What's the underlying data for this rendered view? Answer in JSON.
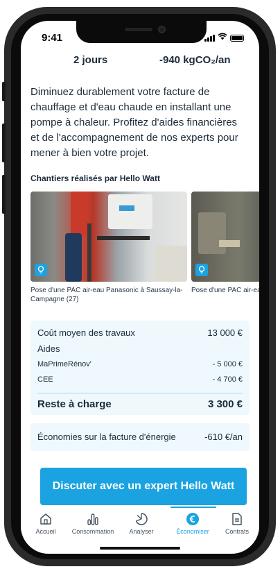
{
  "status_bar": {
    "time": "9:41"
  },
  "stats": {
    "duration": "2 jours",
    "co2": "-940 kgCO₂/an"
  },
  "description": "Diminuez durablement votre facture de chauffage et d'eau chaude en installant une pompe à chaleur. Profitez d'aides financières et de l'accompagnement de nos experts pour mener à bien votre projet.",
  "projects": {
    "title": "Chantiers réalisés par Hello Watt",
    "items": [
      {
        "caption": "Pose d'une PAC air-eau Panasonic à Saussay-la-Campagne (27)"
      },
      {
        "caption": "Pose d'une PAC air-eau Fontaines-Saint-Martin"
      }
    ]
  },
  "costs": {
    "average_label": "Coût moyen des travaux",
    "average_value": "13 000 €",
    "aids_label": "Aides",
    "maprimerenov_label": "MaPrimeRénov'",
    "maprimerenov_value": "- 5 000 €",
    "cee_label": "CEE",
    "cee_value": "- 4 700 €",
    "remaining_label": "Reste à charge",
    "remaining_value": "3 300 €"
  },
  "savings": {
    "label": "Économies sur la facture d'énergie",
    "value": "-610 €/an"
  },
  "cta_label": "Discuter avec un expert Hello Watt",
  "tabs": [
    {
      "label": "Accueil",
      "icon": "home-icon"
    },
    {
      "label": "Consommation",
      "icon": "bar-chart-icon"
    },
    {
      "label": "Analyser",
      "icon": "pie-chart-icon"
    },
    {
      "label": "Économiser",
      "icon": "euro-icon",
      "active": true
    },
    {
      "label": "Contrats",
      "icon": "document-icon"
    }
  ],
  "colors": {
    "accent": "#1aa3e0",
    "text": "#1c2b3a",
    "panel": "#eef8fd"
  }
}
